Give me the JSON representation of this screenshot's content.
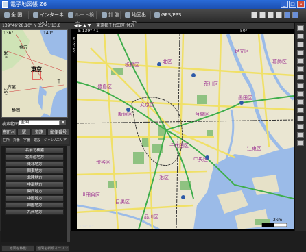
{
  "window": {
    "title": "電子地図帳 Z6"
  },
  "toolbar": {
    "buttons": [
      {
        "label": "全 国",
        "icon": "globe-icon"
      },
      {
        "label": "インターネット",
        "icon": "internet-icon"
      },
      {
        "label": "ルート検索",
        "icon": "route-icon"
      },
      {
        "label": "計 測",
        "icon": "measure-icon"
      },
      {
        "label": "地図出力",
        "icon": "print-icon"
      },
      {
        "label": "GPS/PPS",
        "icon": "gps-icon"
      }
    ]
  },
  "left": {
    "header": "139°46'28.10\" N 35°41'13.8",
    "minimap": {
      "coord_top_left": "136°",
      "coord_top_right": "140°",
      "coord_left": "36°",
      "coord_left_lower": "35°",
      "labels": {
        "kanazawa": "金沢",
        "tokyo": "東京",
        "chiba": "千",
        "yokohama": "古屋",
        "shizuoka": "静岡"
      }
    },
    "search": {
      "label": "検索範囲",
      "value": "全国"
    },
    "tabs": [
      "市町村",
      "駅",
      "道路",
      "郵便番号"
    ],
    "subtabs": [
      "住所",
      "丸番",
      "字番",
      "建設",
      "ジャンル",
      "エリア"
    ],
    "list": [
      "名前で検索",
      "北海道地方",
      "東北地方",
      "関東地方",
      "北陸地方",
      "中部地方",
      "関西地方",
      "中国地方",
      "四国地方",
      "九州地方"
    ],
    "bottom_buttons": [
      "地図を移動",
      "地図を新規オープン"
    ]
  },
  "map": {
    "header": "東京都千代田区 付近",
    "coord_text": "E 139° 41'",
    "coord_right": "50°",
    "left_ruler": "N 35° 45'",
    "bottom_ruler": "139° 43'",
    "scale": "2km",
    "wards": [
      "板橋区",
      "北区",
      "荒川区",
      "足立区",
      "豊島区",
      "文京区",
      "台東区",
      "墨田区",
      "新宿区",
      "千代田区",
      "中央区",
      "江東区",
      "渋谷区",
      "港区",
      "世田谷区",
      "目黒区",
      "品川区",
      "葛飾区"
    ]
  },
  "colors": {
    "water": "#9bbbe8",
    "park": "#8fc281",
    "road_major": "#f0e067",
    "road_expressway": "#3fae4c",
    "land": "#eae6d2",
    "accent": "#2a6bd8"
  }
}
